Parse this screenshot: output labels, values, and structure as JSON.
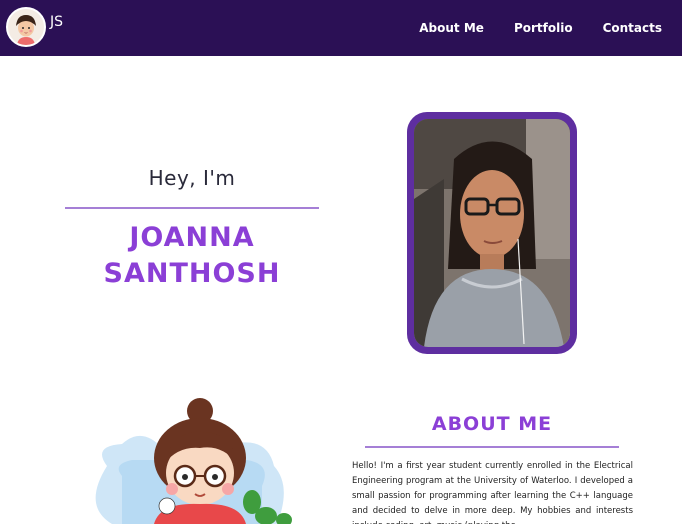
{
  "nav": {
    "logo_text": "JS",
    "links": [
      "About Me",
      "Portfolio",
      "Contacts"
    ]
  },
  "hero": {
    "greeting": "Hey, I'm",
    "name_line1": "JOANNA",
    "name_line2": "SANTHOSH"
  },
  "about": {
    "title": "ABOUT ME",
    "text": "Hello! I'm a first year student currently enrolled in the Electrical Engineering program at the University of Waterloo. I developed a small passion for programming after learning the C++ language and decided to delve in more deep. My hobbies and interests include coding, art, music (playing the"
  },
  "colors": {
    "nav_bg": "#2b1055",
    "accent": "#8b3fd6",
    "frame": "#5e2ea0"
  }
}
